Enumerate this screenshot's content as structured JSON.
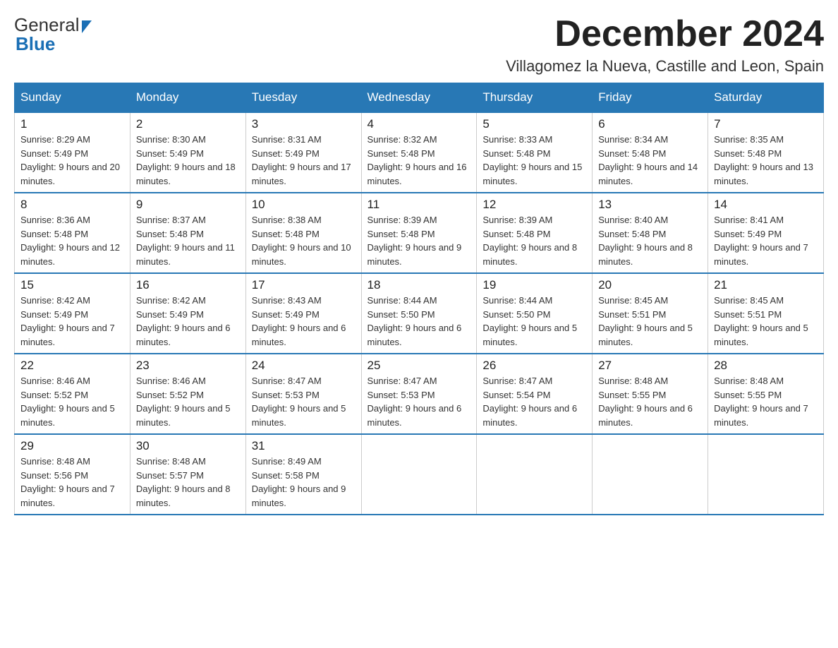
{
  "header": {
    "logo_general": "General",
    "logo_blue": "Blue",
    "month_title": "December 2024",
    "location": "Villagomez la Nueva, Castille and Leon, Spain"
  },
  "days_of_week": [
    "Sunday",
    "Monday",
    "Tuesday",
    "Wednesday",
    "Thursday",
    "Friday",
    "Saturday"
  ],
  "weeks": [
    [
      {
        "day": "1",
        "sunrise": "Sunrise: 8:29 AM",
        "sunset": "Sunset: 5:49 PM",
        "daylight": "Daylight: 9 hours and 20 minutes."
      },
      {
        "day": "2",
        "sunrise": "Sunrise: 8:30 AM",
        "sunset": "Sunset: 5:49 PM",
        "daylight": "Daylight: 9 hours and 18 minutes."
      },
      {
        "day": "3",
        "sunrise": "Sunrise: 8:31 AM",
        "sunset": "Sunset: 5:49 PM",
        "daylight": "Daylight: 9 hours and 17 minutes."
      },
      {
        "day": "4",
        "sunrise": "Sunrise: 8:32 AM",
        "sunset": "Sunset: 5:48 PM",
        "daylight": "Daylight: 9 hours and 16 minutes."
      },
      {
        "day": "5",
        "sunrise": "Sunrise: 8:33 AM",
        "sunset": "Sunset: 5:48 PM",
        "daylight": "Daylight: 9 hours and 15 minutes."
      },
      {
        "day": "6",
        "sunrise": "Sunrise: 8:34 AM",
        "sunset": "Sunset: 5:48 PM",
        "daylight": "Daylight: 9 hours and 14 minutes."
      },
      {
        "day": "7",
        "sunrise": "Sunrise: 8:35 AM",
        "sunset": "Sunset: 5:48 PM",
        "daylight": "Daylight: 9 hours and 13 minutes."
      }
    ],
    [
      {
        "day": "8",
        "sunrise": "Sunrise: 8:36 AM",
        "sunset": "Sunset: 5:48 PM",
        "daylight": "Daylight: 9 hours and 12 minutes."
      },
      {
        "day": "9",
        "sunrise": "Sunrise: 8:37 AM",
        "sunset": "Sunset: 5:48 PM",
        "daylight": "Daylight: 9 hours and 11 minutes."
      },
      {
        "day": "10",
        "sunrise": "Sunrise: 8:38 AM",
        "sunset": "Sunset: 5:48 PM",
        "daylight": "Daylight: 9 hours and 10 minutes."
      },
      {
        "day": "11",
        "sunrise": "Sunrise: 8:39 AM",
        "sunset": "Sunset: 5:48 PM",
        "daylight": "Daylight: 9 hours and 9 minutes."
      },
      {
        "day": "12",
        "sunrise": "Sunrise: 8:39 AM",
        "sunset": "Sunset: 5:48 PM",
        "daylight": "Daylight: 9 hours and 8 minutes."
      },
      {
        "day": "13",
        "sunrise": "Sunrise: 8:40 AM",
        "sunset": "Sunset: 5:48 PM",
        "daylight": "Daylight: 9 hours and 8 minutes."
      },
      {
        "day": "14",
        "sunrise": "Sunrise: 8:41 AM",
        "sunset": "Sunset: 5:49 PM",
        "daylight": "Daylight: 9 hours and 7 minutes."
      }
    ],
    [
      {
        "day": "15",
        "sunrise": "Sunrise: 8:42 AM",
        "sunset": "Sunset: 5:49 PM",
        "daylight": "Daylight: 9 hours and 7 minutes."
      },
      {
        "day": "16",
        "sunrise": "Sunrise: 8:42 AM",
        "sunset": "Sunset: 5:49 PM",
        "daylight": "Daylight: 9 hours and 6 minutes."
      },
      {
        "day": "17",
        "sunrise": "Sunrise: 8:43 AM",
        "sunset": "Sunset: 5:49 PM",
        "daylight": "Daylight: 9 hours and 6 minutes."
      },
      {
        "day": "18",
        "sunrise": "Sunrise: 8:44 AM",
        "sunset": "Sunset: 5:50 PM",
        "daylight": "Daylight: 9 hours and 6 minutes."
      },
      {
        "day": "19",
        "sunrise": "Sunrise: 8:44 AM",
        "sunset": "Sunset: 5:50 PM",
        "daylight": "Daylight: 9 hours and 5 minutes."
      },
      {
        "day": "20",
        "sunrise": "Sunrise: 8:45 AM",
        "sunset": "Sunset: 5:51 PM",
        "daylight": "Daylight: 9 hours and 5 minutes."
      },
      {
        "day": "21",
        "sunrise": "Sunrise: 8:45 AM",
        "sunset": "Sunset: 5:51 PM",
        "daylight": "Daylight: 9 hours and 5 minutes."
      }
    ],
    [
      {
        "day": "22",
        "sunrise": "Sunrise: 8:46 AM",
        "sunset": "Sunset: 5:52 PM",
        "daylight": "Daylight: 9 hours and 5 minutes."
      },
      {
        "day": "23",
        "sunrise": "Sunrise: 8:46 AM",
        "sunset": "Sunset: 5:52 PM",
        "daylight": "Daylight: 9 hours and 5 minutes."
      },
      {
        "day": "24",
        "sunrise": "Sunrise: 8:47 AM",
        "sunset": "Sunset: 5:53 PM",
        "daylight": "Daylight: 9 hours and 5 minutes."
      },
      {
        "day": "25",
        "sunrise": "Sunrise: 8:47 AM",
        "sunset": "Sunset: 5:53 PM",
        "daylight": "Daylight: 9 hours and 6 minutes."
      },
      {
        "day": "26",
        "sunrise": "Sunrise: 8:47 AM",
        "sunset": "Sunset: 5:54 PM",
        "daylight": "Daylight: 9 hours and 6 minutes."
      },
      {
        "day": "27",
        "sunrise": "Sunrise: 8:48 AM",
        "sunset": "Sunset: 5:55 PM",
        "daylight": "Daylight: 9 hours and 6 minutes."
      },
      {
        "day": "28",
        "sunrise": "Sunrise: 8:48 AM",
        "sunset": "Sunset: 5:55 PM",
        "daylight": "Daylight: 9 hours and 7 minutes."
      }
    ],
    [
      {
        "day": "29",
        "sunrise": "Sunrise: 8:48 AM",
        "sunset": "Sunset: 5:56 PM",
        "daylight": "Daylight: 9 hours and 7 minutes."
      },
      {
        "day": "30",
        "sunrise": "Sunrise: 8:48 AM",
        "sunset": "Sunset: 5:57 PM",
        "daylight": "Daylight: 9 hours and 8 minutes."
      },
      {
        "day": "31",
        "sunrise": "Sunrise: 8:49 AM",
        "sunset": "Sunset: 5:58 PM",
        "daylight": "Daylight: 9 hours and 9 minutes."
      },
      null,
      null,
      null,
      null
    ]
  ]
}
